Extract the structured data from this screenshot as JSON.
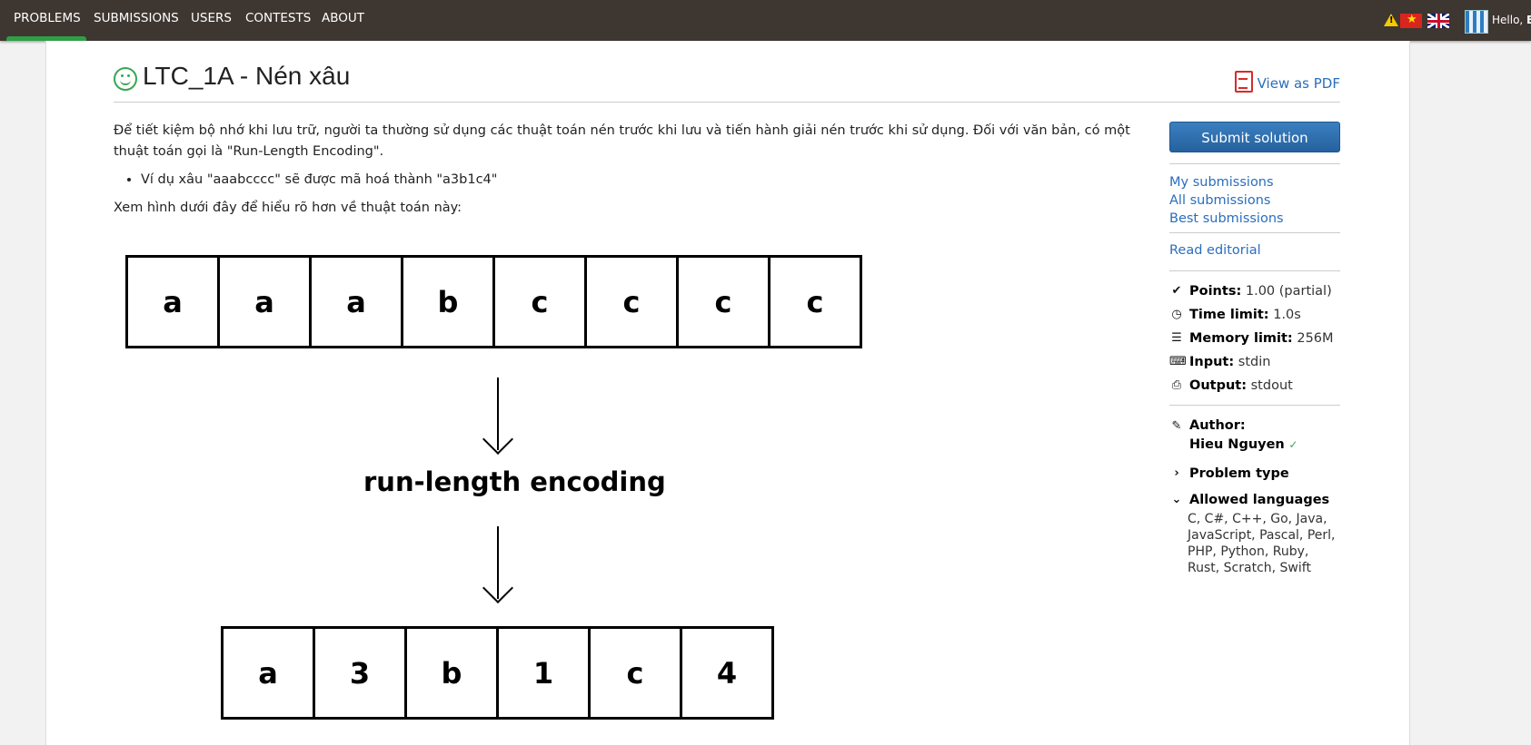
{
  "nav": {
    "items": [
      {
        "label": "PROBLEMS",
        "active": true
      },
      {
        "label": "SUBMISSIONS"
      },
      {
        "label": "USERS"
      },
      {
        "label": "CONTESTS"
      },
      {
        "label": "ABOUT"
      }
    ],
    "greeting": "Hello, ",
    "username": "B",
    "icons": [
      "warning-icon",
      "vietnam-flag-icon",
      "uk-flag-icon",
      "user-avatar"
    ]
  },
  "problem": {
    "title": "LTC_1A - Nén xâu",
    "pdf_label": "View as PDF",
    "statement": {
      "p1": "Để tiết kiệm bộ nhớ khi lưu trữ, người ta thường sử dụng các thuật toán nén trước khi lưu và tiến hành giải nén trước khi sử dụng. Đối với văn bản, có một thuật toán gọi là \"Run-Length Encoding\".",
      "bullet": "Ví dụ xâu \"aaabcccc\" sẽ được mã hoá thành \"a3b1c4\"",
      "p2": "Xem hình dưới đây để hiểu rõ hơn về thuật toán này:"
    },
    "diagram": {
      "input_cells": [
        "a",
        "a",
        "a",
        "b",
        "c",
        "c",
        "c",
        "c"
      ],
      "label": "run-length encoding",
      "output_cells": [
        "a",
        "3",
        "b",
        "1",
        "c",
        "4"
      ]
    }
  },
  "sidebar": {
    "submit": "Submit solution",
    "links": [
      "My submissions",
      "All submissions",
      "Best submissions"
    ],
    "editorial": "Read editorial",
    "info": [
      {
        "label": "Points:",
        "value": "1.00 (partial)",
        "icon": "check-icon"
      },
      {
        "label": "Time limit:",
        "value": "1.0s",
        "icon": "clock-icon"
      },
      {
        "label": "Memory limit:",
        "value": "256M",
        "icon": "server-icon"
      },
      {
        "label": "Input:",
        "value": "stdin",
        "icon": "keyboard-icon"
      },
      {
        "label": "Output:",
        "value": "stdout",
        "icon": "printer-icon"
      }
    ],
    "author_label": "Author:",
    "author_name": "Hieu Nguyen",
    "problem_type_label": "Problem type",
    "allowed_languages_label": "Allowed languages",
    "allowed_languages": "C, C#, C++, Go, Java, JavaScript, Pascal, Perl, PHP, Python, Ruby, Rust, Scratch, Swift"
  },
  "colors": {
    "navbar": "#3e3631",
    "active_tab": "#2f9e45",
    "link": "#2a6ebd",
    "submit_button": "#2a6aad",
    "solved_icon": "#3aa652"
  }
}
